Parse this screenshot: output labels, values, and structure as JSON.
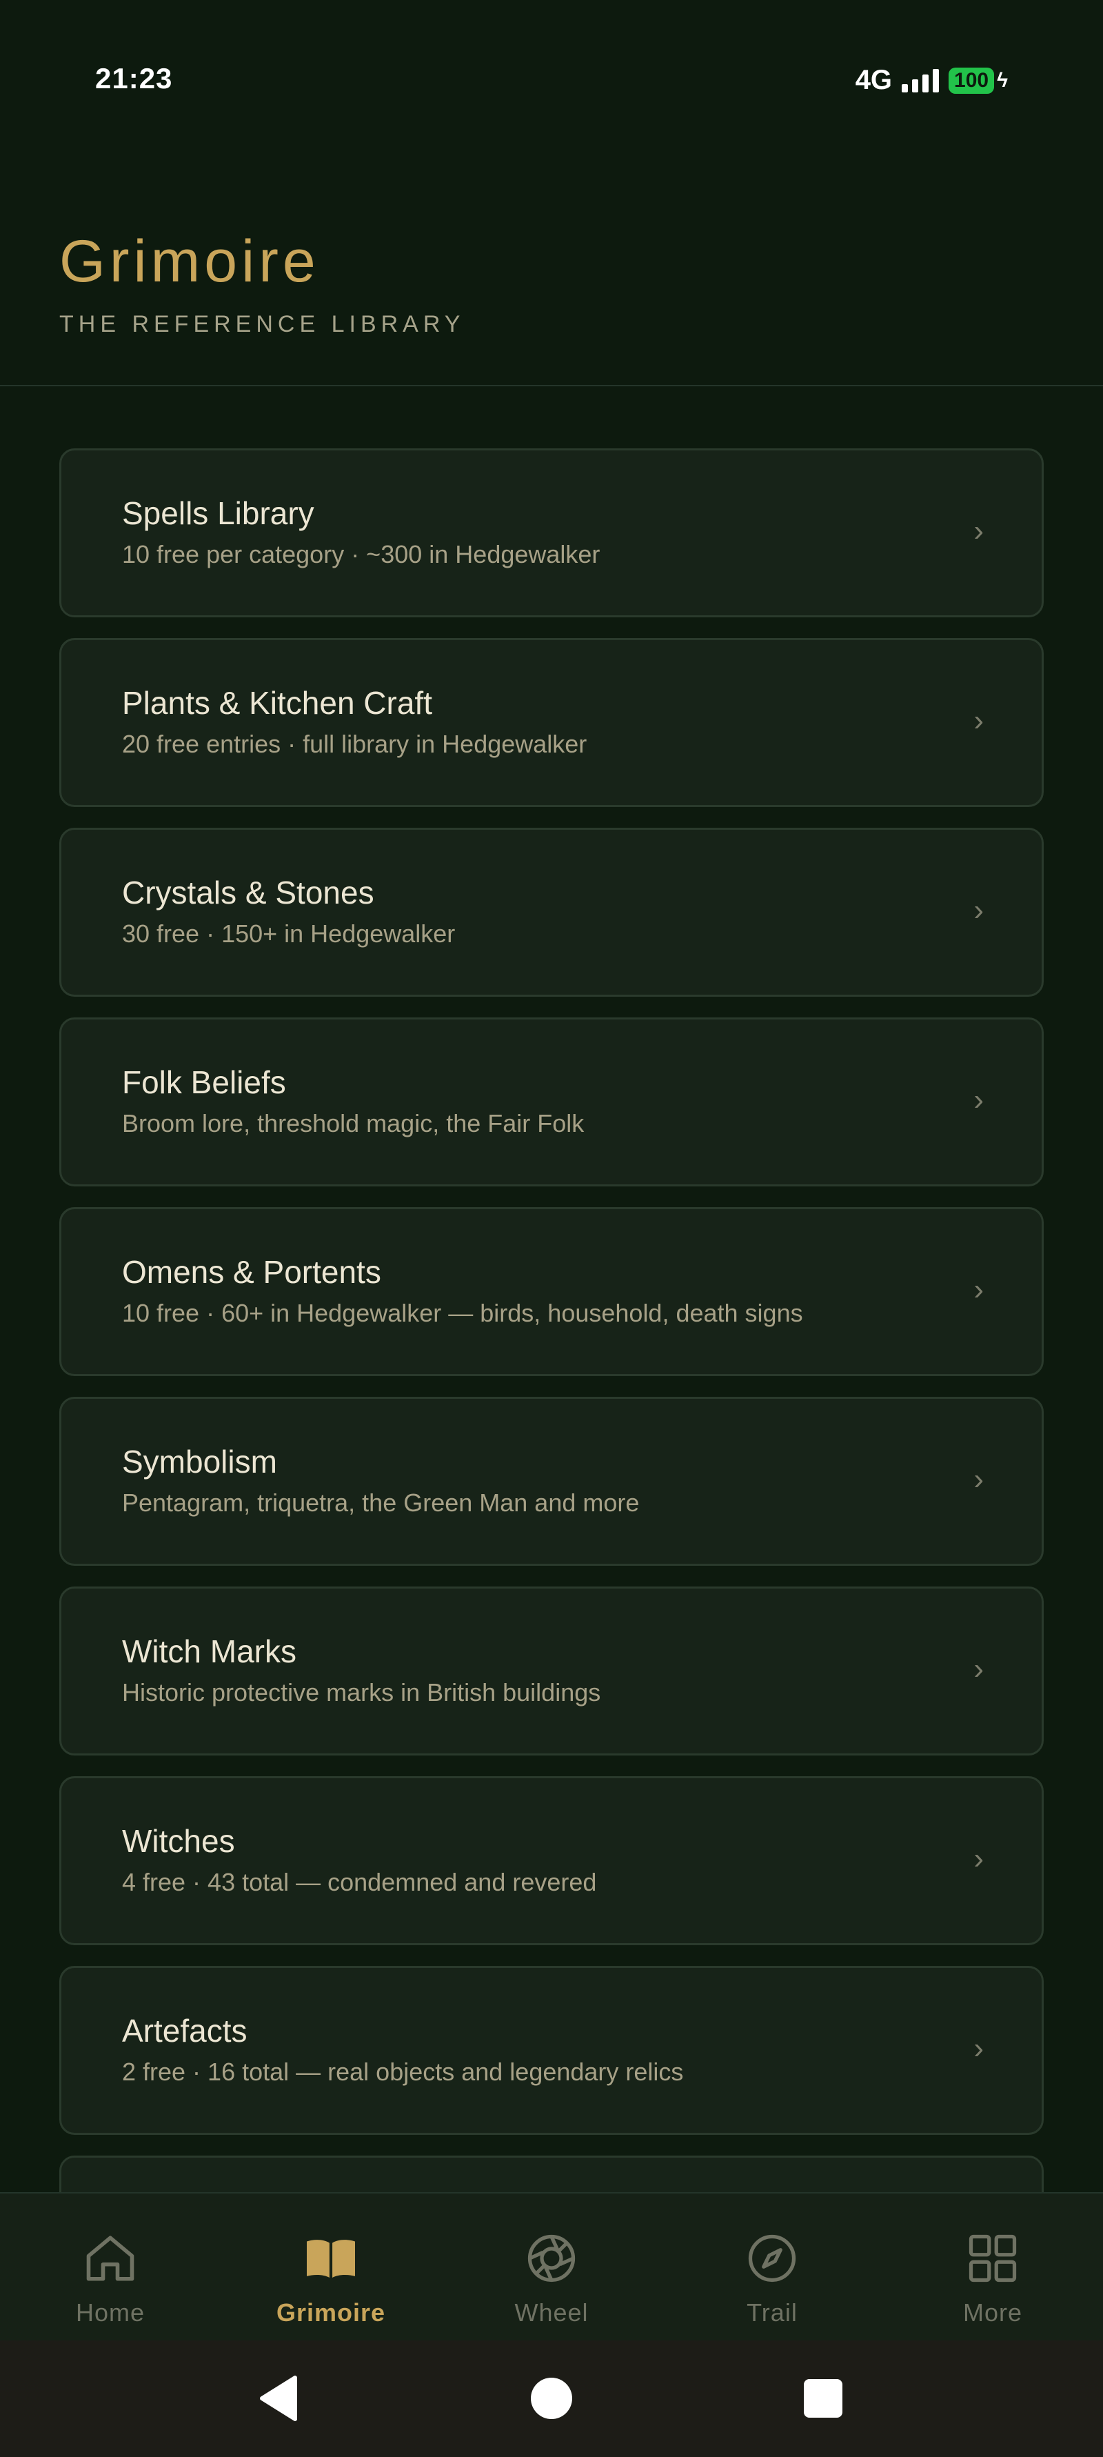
{
  "status": {
    "time": "21:23",
    "network": "4G",
    "battery": "100"
  },
  "header": {
    "title": "Grimoire",
    "subtitle": "THE REFERENCE LIBRARY"
  },
  "categories": [
    {
      "title": "Spells Library",
      "description": "10 free per category · ~300 in Hedgewalker"
    },
    {
      "title": "Plants & Kitchen Craft",
      "description": "20 free entries · full library in Hedgewalker"
    },
    {
      "title": "Crystals & Stones",
      "description": "30 free · 150+ in Hedgewalker"
    },
    {
      "title": "Folk Beliefs",
      "description": "Broom lore, threshold magic, the Fair Folk"
    },
    {
      "title": "Omens & Portents",
      "description": "10 free · 60+ in Hedgewalker — birds, household, death signs"
    },
    {
      "title": "Symbolism",
      "description": "Pentagram, triquetra, the Green Man and more"
    },
    {
      "title": "Witch Marks",
      "description": "Historic protective marks in British buildings"
    },
    {
      "title": "Witches",
      "description": "4 free · 43 total — condemned and revered"
    },
    {
      "title": "Artefacts",
      "description": "2 free · 16 total — real objects and legendary relics"
    }
  ],
  "chevron": "›",
  "nav": {
    "items": [
      {
        "label": "Home",
        "icon": "home-icon"
      },
      {
        "label": "Grimoire",
        "icon": "book-icon"
      },
      {
        "label": "Wheel",
        "icon": "wheel-icon"
      },
      {
        "label": "Trail",
        "icon": "compass-icon"
      },
      {
        "label": "More",
        "icon": "grid-icon"
      }
    ],
    "active": "Grimoire"
  },
  "colors": {
    "background": "#0d1a0e",
    "accent": "#c9a55a",
    "card": "#172318",
    "inactive": "#6f7263"
  }
}
